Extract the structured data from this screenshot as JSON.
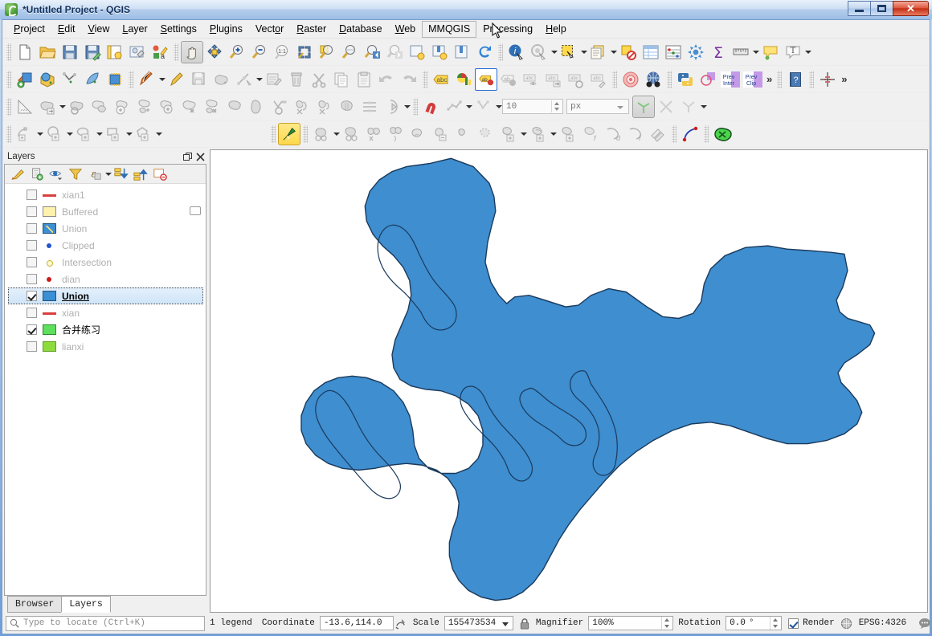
{
  "window": {
    "title": "*Untitled Project - QGIS",
    "app_icon": "qgis-logo-icon",
    "minimize_label": "Minimize",
    "maximize_label": "Maximize",
    "close_label": "✕"
  },
  "menubar": {
    "items": [
      {
        "label": "Project",
        "accel": "P",
        "active": false
      },
      {
        "label": "Edit",
        "accel": "E",
        "active": false
      },
      {
        "label": "View",
        "accel": "V",
        "active": false
      },
      {
        "label": "Layer",
        "accel": "L",
        "active": false
      },
      {
        "label": "Settings",
        "accel": "S",
        "active": false
      },
      {
        "label": "Plugins",
        "accel": "P",
        "active": false
      },
      {
        "label": "Vector",
        "accel": "o",
        "active": false
      },
      {
        "label": "Raster",
        "accel": "R",
        "active": false
      },
      {
        "label": "Database",
        "accel": "D",
        "active": false
      },
      {
        "label": "Web",
        "accel": "W",
        "active": false
      },
      {
        "label": "MMQGIS",
        "accel": "",
        "active": true
      },
      {
        "label": "Processing",
        "accel": "",
        "active": false
      },
      {
        "label": "Help",
        "accel": "H",
        "active": false
      }
    ]
  },
  "toolbars": {
    "snapping": {
      "tolerance_value": "10",
      "units_value": "px"
    }
  },
  "panel": {
    "title": "Layers",
    "undock_label": "Undock",
    "close_label": "Close",
    "toolbar": [
      {
        "name": "open-layer-styling-panel-icon"
      },
      {
        "name": "add-group-icon"
      },
      {
        "name": "manage-layer-visibility-icon"
      },
      {
        "name": "filter-legend-icon"
      },
      {
        "name": "filter-legend-by-expression-icon"
      },
      {
        "name": "expand-all-icon"
      },
      {
        "name": "collapse-all-icon"
      },
      {
        "name": "remove-layer-icon"
      }
    ],
    "layers": [
      {
        "name": "xian1",
        "checked": false,
        "selected": false,
        "symbol": "line-red",
        "badge": ""
      },
      {
        "name": "Buffered",
        "checked": false,
        "selected": false,
        "symbol": "fill-yellow",
        "badge": "memory-layer-icon"
      },
      {
        "name": "Union",
        "checked": false,
        "selected": false,
        "symbol": "fill-edit",
        "badge": ""
      },
      {
        "name": "Clipped",
        "checked": false,
        "selected": false,
        "symbol": "dot-blue",
        "badge": ""
      },
      {
        "name": "Intersection",
        "checked": false,
        "selected": false,
        "symbol": "dot-ring",
        "badge": ""
      },
      {
        "name": "dian",
        "checked": false,
        "selected": false,
        "symbol": "dot-red",
        "badge": ""
      },
      {
        "name": "Union",
        "checked": true,
        "selected": true,
        "symbol": "fill-blue",
        "badge": ""
      },
      {
        "name": "xian",
        "checked": false,
        "selected": false,
        "symbol": "line-red",
        "badge": ""
      },
      {
        "name": "合并练习",
        "checked": true,
        "selected": false,
        "symbol": "fill-green",
        "badge": ""
      },
      {
        "name": "lianxi",
        "checked": false,
        "selected": false,
        "symbol": "fill-green2",
        "badge": ""
      }
    ],
    "tabs": [
      {
        "label": "Browser",
        "active": false
      },
      {
        "label": "Layers",
        "active": true
      }
    ]
  },
  "map": {
    "fill_color": "#3e8ed0",
    "stroke_color": "#1b3a5c",
    "background": "#ffffff"
  },
  "statusbar": {
    "locate_placeholder": "Type to locate (Ctrl+K)",
    "messages": "1 legend",
    "coordinate_label": "Coordinate",
    "coordinate_value": "-13.6,114.0",
    "scale_label": "Scale",
    "scale_value": "155473534",
    "magnifier_label": "Magnifier",
    "magnifier_value": "100%",
    "rotation_label": "Rotation",
    "rotation_value": "0.0",
    "rotation_unit": "°",
    "render_label": "Render",
    "crs_value": "EPSG:4326",
    "lock_icon": "lock-icon",
    "globe_icon": "globe-icon",
    "message_icon": "speech-bubble-icon",
    "toggle_extents_icon": "toggle-extents-icon"
  }
}
